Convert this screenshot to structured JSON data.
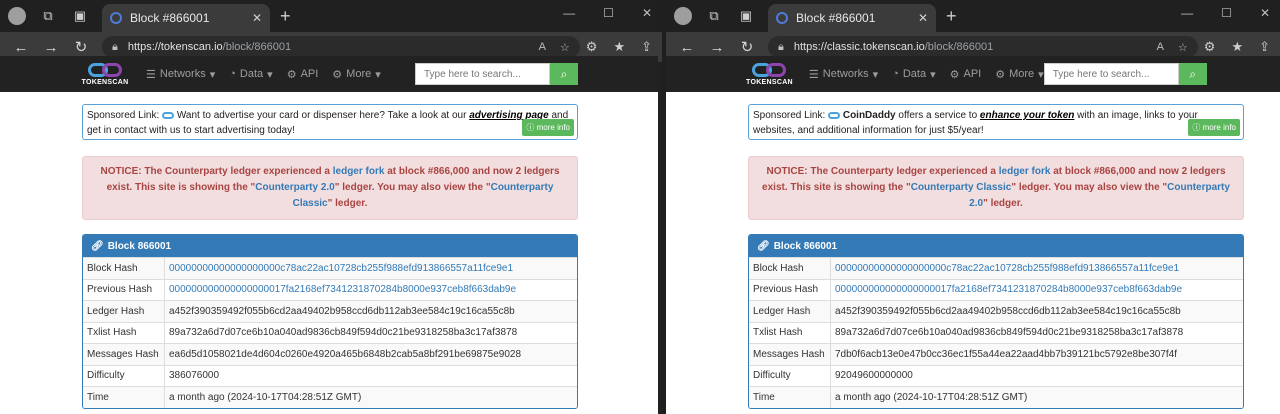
{
  "windows": [
    {
      "tab_title": "Block #866001",
      "url_host": "https://tokenscan.io",
      "url_path": "/block/866001",
      "site": {
        "logo_text": "TOKENSCAN",
        "menu": [
          "Networks",
          "Data",
          "API",
          "More"
        ],
        "search_placeholder": "Type here to search..."
      },
      "sponsor": {
        "prefix": "Sponsored Link:",
        "brand": "",
        "text1": " Want to advertise your card or dispenser here? Take a look at our ",
        "link": "advertising page",
        "text2": " and get in contact with us to start advertising today!",
        "more": "more info"
      },
      "notice": {
        "p1": "NOTICE: The Counterparty ledger experienced a ",
        "fork": "ledger fork",
        "p2": " at block #866,000 and now 2 ledgers exist. This site is showing the \"",
        "cur": "Counterparty 2.0",
        "p3": "\" ledger. You may also view the \"",
        "other": "Counterparty Classic",
        "p4": "\" ledger."
      },
      "block": {
        "title": "Block 866001",
        "rows": [
          {
            "k": "Block Hash",
            "v": "00000000000000000000c78ac22ac10728cb255f988efd913866557a11fce9e1",
            "link": true
          },
          {
            "k": "Previous Hash",
            "v": "000000000000000000017fa2168ef7341231870284b8000e937ceb8f663dab9e",
            "link": true
          },
          {
            "k": "Ledger Hash",
            "v": "a452f390359492f055b6cd2aa49402b958ccd6db112ab3ee584c19c16ca55c8b",
            "link": false
          },
          {
            "k": "Txlist Hash",
            "v": "89a732a6d7d07ce6b10a040ad9836cb849f594d0c21be9318258ba3c17af3878",
            "link": false
          },
          {
            "k": "Messages Hash",
            "v": "ea6d5d1058021de4d604c0260e4920a465b6848b2cab5a8bf291be69875e9028",
            "link": false
          },
          {
            "k": "Difficulty",
            "v": "386076000",
            "link": false
          },
          {
            "k": "Time",
            "v": "a month ago (2024-10-17T04:28:51Z GMT)",
            "link": false
          }
        ]
      }
    },
    {
      "tab_title": "Block #866001",
      "url_host": "https://classic.tokenscan.io",
      "url_path": "/block/866001",
      "site": {
        "logo_text": "TOKENSCAN",
        "menu": [
          "Networks",
          "Data",
          "API",
          "More"
        ],
        "search_placeholder": "Type here to search..."
      },
      "sponsor": {
        "prefix": "Sponsored Link:",
        "brand": "CoinDaddy",
        "text1": " offers a service to ",
        "link": "enhance your token",
        "text2": " with an image, links to your websites, and additional information for just $5/year!",
        "more": "more info"
      },
      "notice": {
        "p1": "NOTICE: The Counterparty ledger experienced a ",
        "fork": "ledger fork",
        "p2": " at block #866,000 and now 2 ledgers exist. This site is showing the \"",
        "cur": "Counterparty Classic",
        "p3": "\" ledger. You may also view the \"",
        "other": "Counterparty 2.0",
        "p4": "\" ledger."
      },
      "block": {
        "title": "Block 866001",
        "rows": [
          {
            "k": "Block Hash",
            "v": "00000000000000000000c78ac22ac10728cb255f988efd913866557a11fce9e1",
            "link": true
          },
          {
            "k": "Previous Hash",
            "v": "000000000000000000017fa2168ef7341231870284b8000e937ceb8f663dab9e",
            "link": true
          },
          {
            "k": "Ledger Hash",
            "v": "a452f390359492f055b6cd2aa49402b958ccd6db112ab3ee584c19c16ca55c8b",
            "link": false
          },
          {
            "k": "Txlist Hash",
            "v": "89a732a6d7d07ce6b10a040ad9836cb849f594d0c21be9318258ba3c17af3878",
            "link": false
          },
          {
            "k": "Messages Hash",
            "v": "7db0f6acb13e0e47b0cc36ec1f55a44ea22aad4bb7b39121bc5792e8be307f4f",
            "link": false
          },
          {
            "k": "Difficulty",
            "v": "92049600000000",
            "link": false
          },
          {
            "k": "Time",
            "v": "a month ago (2024-10-17T04:28:51Z GMT)",
            "link": false
          }
        ]
      }
    }
  ]
}
